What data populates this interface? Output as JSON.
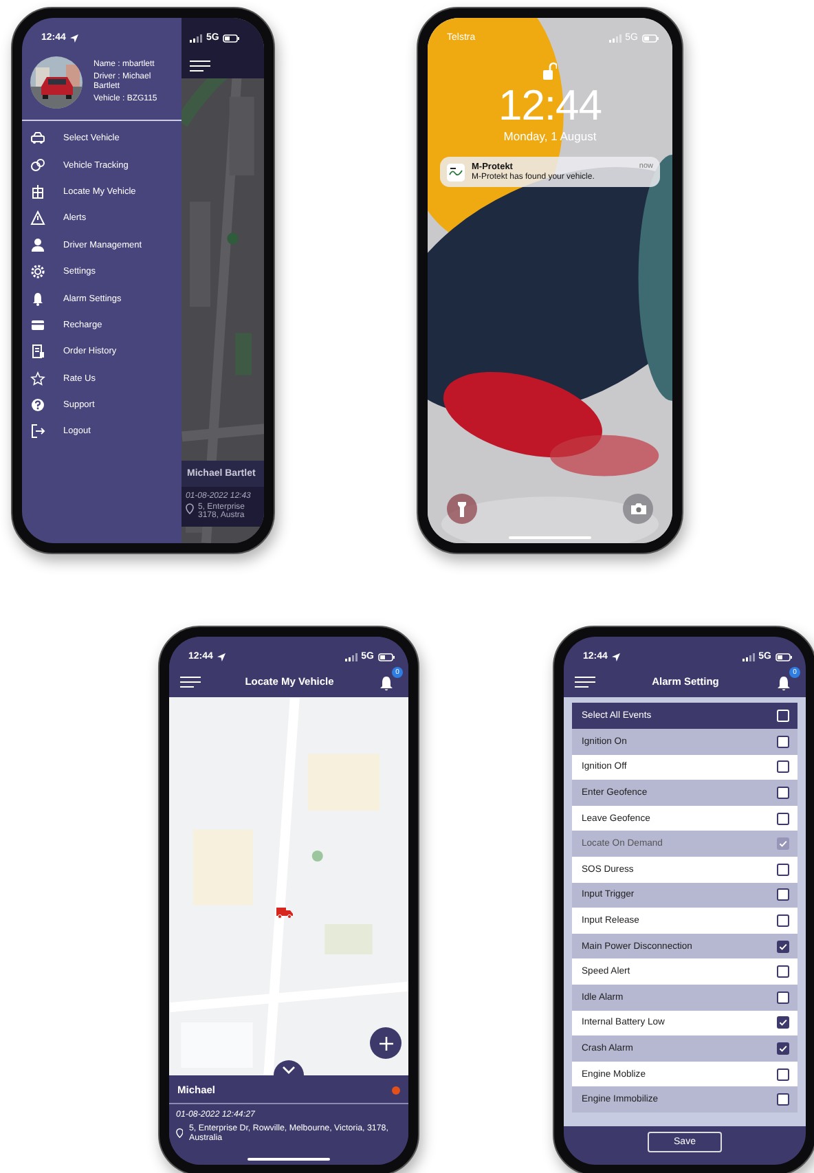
{
  "menu_screen": {
    "status_bar": {
      "time": "12:44",
      "network": "5G"
    },
    "profile": {
      "name": "Name : mbartlett",
      "driver": "Driver : Michael Bartlett",
      "vehicle": "Vehicle : BZG115"
    },
    "menu_items": [
      {
        "label": "Select Vehicle"
      },
      {
        "label": "Vehicle Tracking"
      },
      {
        "label": "Locate My Vehicle"
      },
      {
        "label": "Alerts"
      },
      {
        "label": "Driver Management"
      },
      {
        "label": "Settings"
      },
      {
        "label": "Alarm Settings"
      },
      {
        "label": "Recharge"
      },
      {
        "label": "Order History"
      },
      {
        "label": "Rate Us"
      },
      {
        "label": "Support"
      },
      {
        "label": "Logout"
      }
    ],
    "behind_drawer": {
      "driver": "Michael Bartlet",
      "time": "01-08-2022 12:43",
      "address_line_1": "5, Enterprise",
      "address_line_2": "3178, Austra"
    }
  },
  "lock_screen": {
    "carrier": "Telstra",
    "network": "5G",
    "time": "12:44",
    "date": "Monday, 1 August",
    "notification": {
      "app": "M-Protekt",
      "message": "M-Protekt has found your vehicle.",
      "time": "now"
    }
  },
  "locate_screen": {
    "status_bar": {
      "time": "12:44",
      "network": "5G"
    },
    "title": "Locate My Vehicle",
    "badge": "0",
    "driver": {
      "name": "Michael",
      "color": "#e2501c"
    },
    "timestamp": "01-08-2022 12:44:27",
    "address": "5, Enterprise Dr, Rowville, Melbourne, Victoria, 3178, Australia"
  },
  "alarm_screen": {
    "status_bar": {
      "time": "12:44",
      "network": "5G"
    },
    "title": "Alarm Setting",
    "badge": "0",
    "select_all": {
      "label": "Select All Events",
      "checked": false
    },
    "events": [
      {
        "label": "Ignition On",
        "checked": false,
        "disabled": false
      },
      {
        "label": "Ignition Off",
        "checked": false,
        "disabled": false
      },
      {
        "label": "Enter Geofence",
        "checked": false,
        "disabled": false
      },
      {
        "label": "Leave Geofence",
        "checked": false,
        "disabled": false
      },
      {
        "label": "Locate On Demand",
        "checked": true,
        "disabled": true
      },
      {
        "label": "SOS Duress",
        "checked": false,
        "disabled": false
      },
      {
        "label": "Input Trigger",
        "checked": false,
        "disabled": false
      },
      {
        "label": "Input Release",
        "checked": false,
        "disabled": false
      },
      {
        "label": "Main Power Disconnection",
        "checked": true,
        "disabled": false
      },
      {
        "label": "Speed Alert",
        "checked": false,
        "disabled": false
      },
      {
        "label": "Idle Alarm",
        "checked": false,
        "disabled": false
      },
      {
        "label": "Internal Battery Low",
        "checked": true,
        "disabled": false
      },
      {
        "label": "Crash Alarm",
        "checked": true,
        "disabled": false
      },
      {
        "label": "Engine Moblize",
        "checked": false,
        "disabled": false
      },
      {
        "label": "Engine Immobilize",
        "checked": false,
        "disabled": false
      }
    ],
    "save": "Save"
  }
}
